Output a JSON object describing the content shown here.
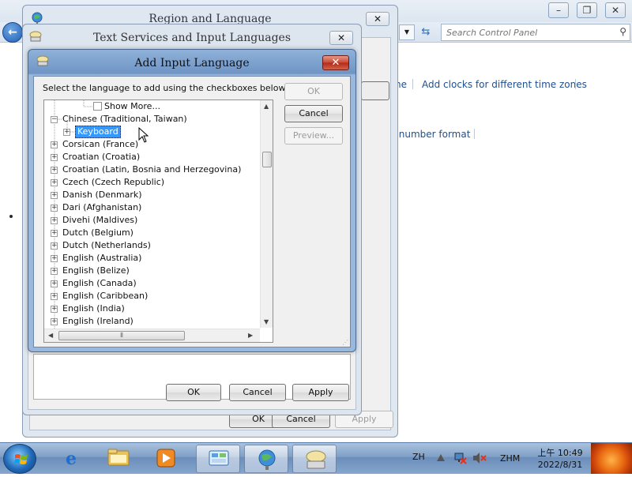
{
  "control_panel": {
    "search_placeholder": "Search Control Panel",
    "link_fragment": "ne",
    "link_clocks": "Add clocks for different time zones",
    "link_number_format": "r number format"
  },
  "region_dialog": {
    "title": "Region and Language",
    "ok": "OK",
    "cancel": "Cancel",
    "apply": "Apply"
  },
  "text_services_dialog": {
    "title": "Text Services and Input Languages",
    "ok": "OK",
    "cancel": "Cancel",
    "apply": "Apply"
  },
  "add_input_dialog": {
    "title": "Add Input Language",
    "instruction": "Select the language to add using the checkboxes below.",
    "ok": "OK",
    "cancel": "Cancel",
    "preview": "Preview...",
    "tree": {
      "show_more": "Show More...",
      "items": [
        {
          "label": "Chinese (Traditional, Taiwan)",
          "expanded": true
        },
        {
          "label": "Keyboard",
          "selected": true,
          "child": true
        },
        {
          "label": "Corsican (France)"
        },
        {
          "label": "Croatian (Croatia)"
        },
        {
          "label": "Croatian (Latin, Bosnia and Herzegovina)"
        },
        {
          "label": "Czech (Czech Republic)"
        },
        {
          "label": "Danish (Denmark)"
        },
        {
          "label": "Dari (Afghanistan)"
        },
        {
          "label": "Divehi (Maldives)"
        },
        {
          "label": "Dutch (Belgium)"
        },
        {
          "label": "Dutch (Netherlands)"
        },
        {
          "label": "English (Australia)"
        },
        {
          "label": "English (Belize)"
        },
        {
          "label": "English (Canada)"
        },
        {
          "label": "English (Caribbean)"
        },
        {
          "label": "English (India)"
        },
        {
          "label": "English (Ireland)"
        }
      ]
    }
  },
  "taskbar": {
    "lang": "ZH",
    "ime": "ZHM",
    "time": "上午 10:49",
    "date": "2022/8/31"
  }
}
